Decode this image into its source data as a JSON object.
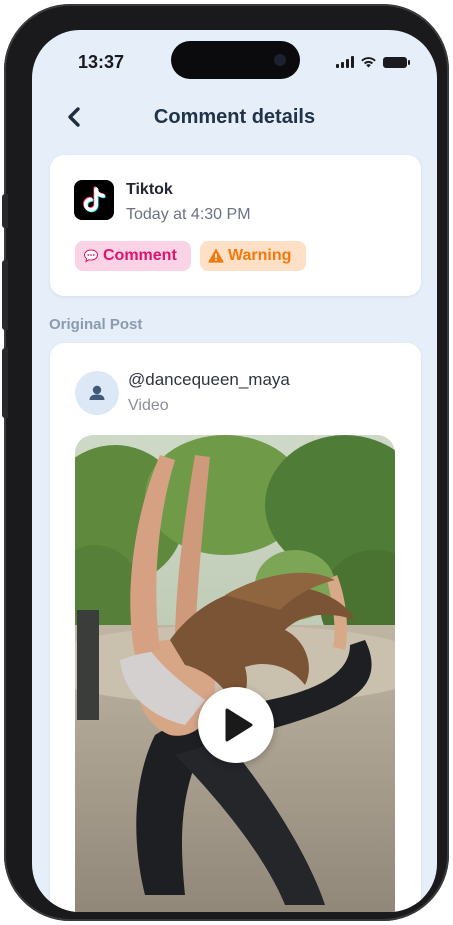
{
  "status_bar": {
    "time": "13:37"
  },
  "header": {
    "title": "Comment details",
    "back_icon": "chevron-left-icon"
  },
  "notification": {
    "app_name": "Tiktok",
    "timestamp": "Today at 4:30 PM",
    "app_icon": "tiktok-logo",
    "badges": [
      {
        "label": "Comment",
        "icon": "speech-bubble-icon",
        "color": "#e0126b",
        "bg": "#fbd3e6"
      },
      {
        "label": "Warning",
        "icon": "warning-triangle-icon",
        "color": "#f07a0e",
        "bg": "#fde0c5"
      }
    ]
  },
  "original_post": {
    "section_label": "Original Post",
    "username": "@dancequeen_maya",
    "media_type": "Video",
    "avatar_icon": "person-icon",
    "play_icon": "play-icon"
  },
  "colors": {
    "background": "#e5eef9",
    "title": "#203349",
    "accent_pink": "#e0126b",
    "accent_orange": "#f07a0e"
  }
}
